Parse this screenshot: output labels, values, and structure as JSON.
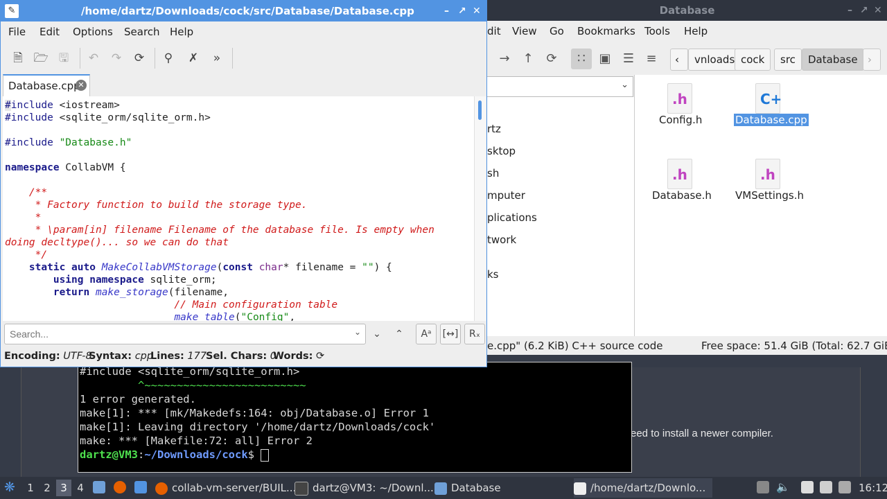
{
  "desktop": {
    "background_text": "eed to install a newer compiler."
  },
  "terminal": {
    "lines": [
      {
        "text": "#include <sqlite_orm/sqlite_orm.h>",
        "color": "#d8d8d8"
      },
      {
        "text": "         ^~~~~~~~~~~~~~~~~~~~~~~~~~",
        "color": "#4ee04e"
      },
      {
        "text": "1 error generated.",
        "color": "#d8d8d8"
      },
      {
        "text": "make[1]: *** [mk/Makedefs:164: obj/Database.o] Error 1",
        "color": "#d8d8d8"
      },
      {
        "text": "make[1]: Leaving directory '/home/dartz/Downloads/cock'",
        "color": "#d8d8d8"
      },
      {
        "text": "make: *** [Makefile:72: all] Error 2",
        "color": "#d8d8d8"
      }
    ],
    "prompt_user": "dartz@VM3",
    "prompt_sep": ":",
    "prompt_path": "~/Downloads/cock",
    "prompt_symbol": "$"
  },
  "file_manager": {
    "title": "Database",
    "menu": [
      "dit",
      "View",
      "Go",
      "Bookmarks",
      "Tools",
      "Help"
    ],
    "breadcrumbs": [
      "vnloads",
      "cock",
      "src",
      "Database"
    ],
    "places": [
      "rtz",
      "sktop",
      "sh",
      "mputer",
      "plications",
      "twork",
      "ks"
    ],
    "files": [
      {
        "name": "Config.h",
        "glyph": ".h",
        "selected": false
      },
      {
        "name": "Database.cpp",
        "glyph": "C+",
        "selected": true
      },
      {
        "name": "Database.h",
        "glyph": ".h",
        "selected": false
      },
      {
        "name": "VMSettings.h",
        "glyph": ".h",
        "selected": false
      }
    ],
    "status_left": "e.cpp\" (6.2 KiB) C++ source code",
    "status_right": "Free space: 51.4 GiB (Total: 62.7 GiB)"
  },
  "editor": {
    "title": "/home/dartz/Downloads/cock/src/Database/Database.cpp",
    "menu": [
      "File",
      "Edit",
      "Options",
      "Search",
      "Help"
    ],
    "tab_label": "Database.cpp",
    "search_placeholder": "Search...",
    "status": {
      "encoding_label": "Encoding:",
      "encoding_value": "UTF-8",
      "syntax_label": "Syntax:",
      "syntax_value": "cpp",
      "lines_label": "Lines:",
      "lines_value": "177",
      "sel_label": "Sel. Chars:",
      "sel_value": "0",
      "words_label": "Words:"
    }
  },
  "taskbar": {
    "workspaces": [
      "1",
      "2",
      "3",
      "4"
    ],
    "active_workspace": "3",
    "tasks": [
      {
        "label": "collab-vm-server/BUIL..."
      },
      {
        "label": "dartz@VM3: ~/Downl..."
      },
      {
        "label": "Database"
      },
      {
        "label": "/home/dartz/Downlo..."
      }
    ],
    "clock": "16:12"
  },
  "colors": {
    "accent": "#5294e2",
    "titlebar_dark": "#2f343f",
    "terminal_bg": "#000000"
  }
}
